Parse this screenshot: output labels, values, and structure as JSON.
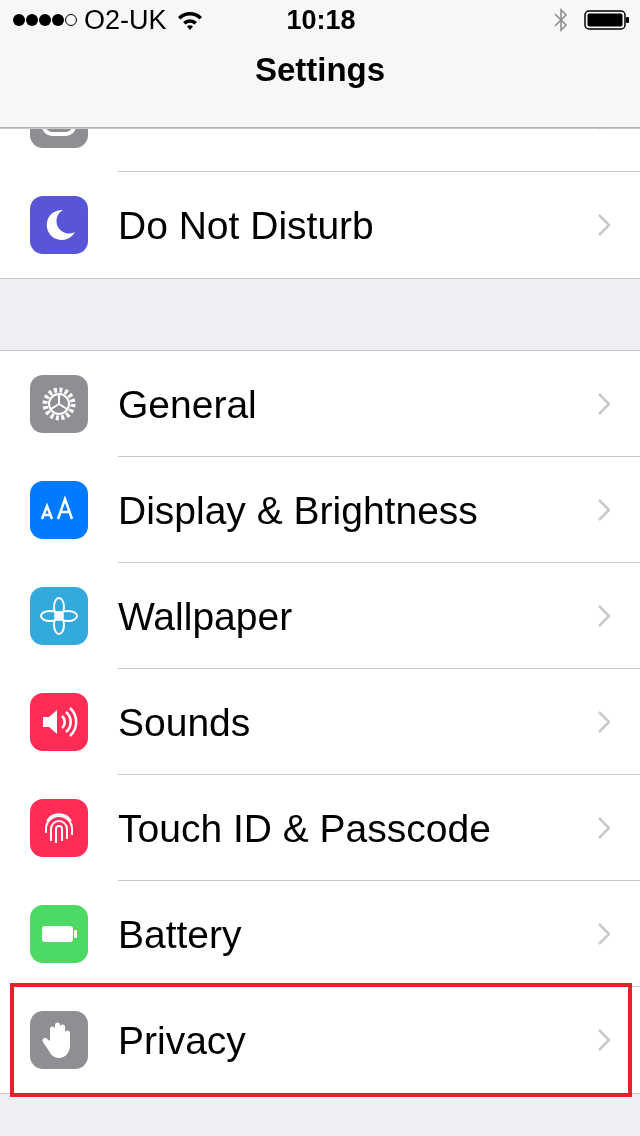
{
  "status_bar": {
    "carrier": "O2-UK",
    "time": "10:18"
  },
  "navigation": {
    "title": "Settings"
  },
  "groups": [
    {
      "rows": [
        {
          "kind": "switches",
          "color": "#8e8e93",
          "highlighted": false
        },
        {
          "label": "Do Not Disturb",
          "kind": "moon",
          "color": "#5856d6",
          "highlighted": false
        }
      ]
    },
    {
      "rows": [
        {
          "label": "General",
          "kind": "gear",
          "color": "#8e8e93",
          "highlighted": false
        },
        {
          "label": "Display & Brightness",
          "kind": "letters",
          "color": "#007aff",
          "highlighted": false
        },
        {
          "label": "Wallpaper",
          "kind": "flower",
          "color": "#34aadc",
          "highlighted": false
        },
        {
          "label": "Sounds",
          "kind": "speaker",
          "color": "#ff2d55",
          "highlighted": false
        },
        {
          "label": "Touch ID & Passcode",
          "kind": "fingerprint",
          "color": "#ff2d55",
          "highlighted": false
        },
        {
          "label": "Battery",
          "kind": "battery",
          "color": "#4cd964",
          "highlighted": false
        },
        {
          "label": "Privacy",
          "kind": "hand",
          "color": "#8e8e93",
          "highlighted": true
        }
      ]
    }
  ]
}
